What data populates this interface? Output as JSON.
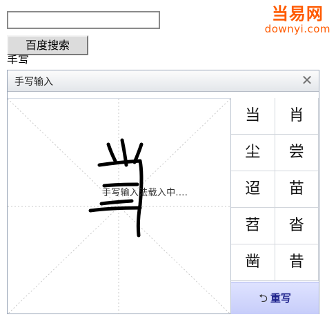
{
  "search": {
    "input_value": "",
    "button_label": "百度搜索"
  },
  "handwriting_label": "手写",
  "logo": {
    "main": "当易网",
    "sub": "downyi.com",
    "color": "#ff5a00"
  },
  "panel": {
    "title": "手写输入",
    "close_glyph": "✕",
    "loading_text": "手写输入法载入中....",
    "candidates": [
      "当",
      "肖",
      "尘",
      "尝",
      "迢",
      "苗",
      "苕",
      "沓",
      "凿",
      "昔"
    ],
    "rewrite_label": "重写",
    "rewrite_icon": "undo-arrow-icon"
  }
}
